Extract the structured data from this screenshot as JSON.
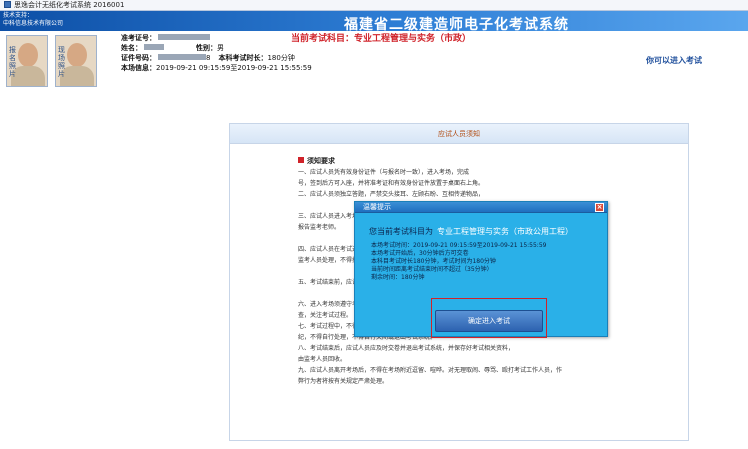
{
  "window": {
    "title": "思逸会计无纸化考试系统 2016001"
  },
  "header": {
    "support_line1": "技术支持：",
    "support_line2": "中科信息技术有限公司",
    "system_title": "福建省二级建造师电子化考试系统",
    "current_subject": "当前考试科目：专业工程管理与实务（市政）",
    "enter_hint": "你可以进入考试",
    "photo1_label": "报名照片",
    "photo2_label": "现场照片",
    "candidate": {
      "ticket_label": "准考证号：",
      "name_label": "姓名：",
      "gender_label": "性别：",
      "gender_value": "男",
      "id_label": "证件号码：",
      "id_suffix": "8",
      "duration_label": "本科考试时长：",
      "duration_value": "180分钟",
      "session_label": "本场信息：",
      "session_value": "2019-09-21 09:15:59至2019-09-21 15:55:59"
    }
  },
  "notice": {
    "header": "应试人员须知",
    "title": "须知要求",
    "lines": [
      "一、应试人员凭有效身份证件（与报名时一致），进入考场，完成",
      "号，签到后方可入座，并将准考证和有效身份证件放置于桌面右上角。",
      "二、应试人员须独立答题，严禁交头接耳、左顾右盼、互相传递物品，",
      "",
      "三、应试人员进入考场后，认真核对考试信息，如有疑问，及时",
      "报告监考老师。",
      "",
      "四、应试人员在考试过程中，如遇计算机故障，请举手示意，由",
      "监考人员处理，不得擅自操作。",
      "",
      "五、考试结束前，应试人员不得提前离场。",
      "",
      "六、进入考场须遵守考场规则，服从考场工作人员的管理和检",
      "查，关注考试过程。",
      "七、考试过程中，不得携带通讯设备、书籍、资料等进入考场，违者按",
      "纪，不得自行处理，不得自行关闭或退出考试系统。",
      "八、考试结束后，应试人员应及时交卷并退出考试系统，并保存好考试相关资料，",
      "由监考人员回收。",
      "九、应试人员离开考场后，不得在考场附近逗留、喧哗。对无理取闹、辱骂、殴打考试工作人员，作",
      "弊行为者将按有关规定严肃处理。"
    ]
  },
  "modal": {
    "title": "温馨提示",
    "subject_prefix": "您当前考试科目为",
    "subject_value": "专业工程管理与实务（市政公用工程）",
    "info_lines": [
      "本场考试时间：2019-09-21 09:15:59至2019-09-21 15:55:59",
      "本场考试开始后，30分钟后方可交卷",
      "本科目考试时长180分钟，考试时间为180分钟",
      "当前时间距离考试结束时间不超过（35分钟）",
      "剩余时间：180分钟"
    ],
    "confirm_label": "确定进入考试"
  }
}
